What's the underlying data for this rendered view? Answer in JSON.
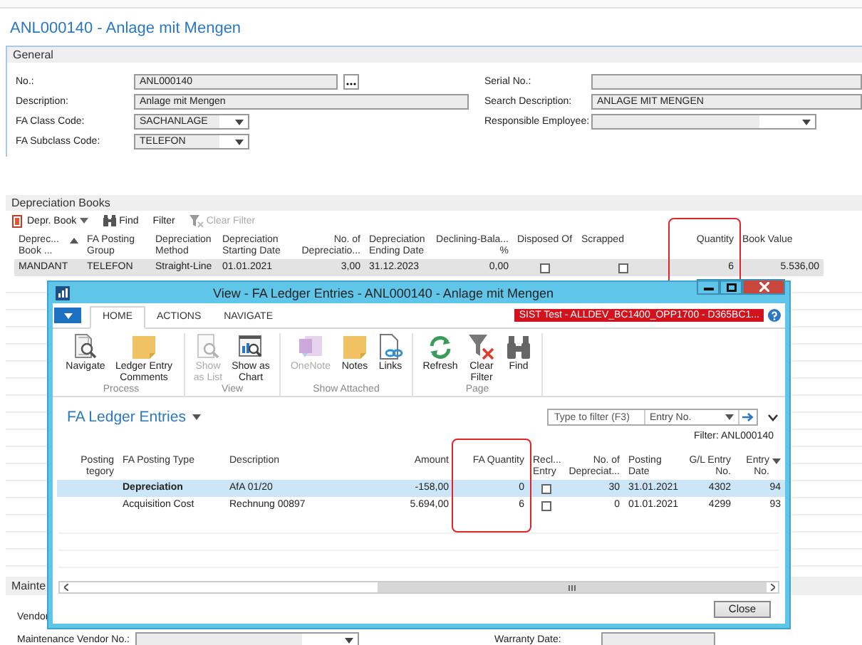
{
  "page": {
    "title": "ANL000140 - Anlage mit Mengen"
  },
  "general": {
    "heading": "General",
    "left_fields": [
      {
        "label": "No.:",
        "value": "ANL000140",
        "kind": "lookup"
      },
      {
        "label": "Description:",
        "value": "Anlage mit Mengen",
        "kind": "text"
      },
      {
        "label": "FA Class Code:",
        "value": "SACHANLAGE",
        "kind": "select"
      },
      {
        "label": "FA Subclass Code:",
        "value": "TELEFON",
        "kind": "select"
      }
    ],
    "right_fields": [
      {
        "label": "Serial No.:",
        "kind": "text"
      },
      {
        "label": "Search Description:",
        "value": "ANLAGE MIT MENGEN",
        "kind": "text"
      },
      {
        "label": "Responsible Employee:",
        "kind": "select"
      }
    ]
  },
  "depreciation_books": {
    "heading": "Depreciation Books",
    "toolbar": [
      {
        "label": "Depr. Book",
        "disabled": false
      },
      {
        "label": "Find",
        "disabled": false
      },
      {
        "label": "Filter",
        "disabled": false
      },
      {
        "label": "Clear Filter",
        "disabled": true
      }
    ],
    "columns": [
      {
        "label": "Deprec... Book ...",
        "sorted": true,
        "highlighted": false
      },
      {
        "label": "FA Posting Group",
        "sorted": false,
        "highlighted": false
      },
      {
        "label": "Depreciation Method",
        "sorted": false,
        "highlighted": false
      },
      {
        "label": "Depreciation Starting Date",
        "sorted": false,
        "highlighted": false
      },
      {
        "label": "No. of Depreciatio...",
        "sorted": false,
        "highlighted": false
      },
      {
        "label": "Depreciation Ending Date",
        "sorted": false,
        "highlighted": false
      },
      {
        "label": "Declining-Bala... %",
        "sorted": false,
        "highlighted": false
      },
      {
        "label": "Disposed Of",
        "sorted": false,
        "highlighted": false
      },
      {
        "label": "Scrapped",
        "sorted": false,
        "highlighted": false
      },
      {
        "label": "Quantity",
        "sorted": false,
        "highlighted": true
      },
      {
        "label": "Book Value",
        "sorted": false,
        "highlighted": false
      }
    ],
    "rows": [
      {
        "selected": true,
        "cells": [
          "MANDANT",
          "TELEFON",
          "Straight-Line",
          "01.01.2021",
          "3,00",
          "31.12.2023",
          "0,00",
          {
            "checked": false
          },
          {
            "checked": false
          },
          "6",
          "5.536,00"
        ]
      }
    ]
  },
  "maintenance": {
    "heading": "Mainte",
    "left_fields": [
      {
        "label": "Vendor",
        "kind": "covered"
      },
      {
        "label": "Maintenance Vendor No.:",
        "kind": "select"
      }
    ],
    "right_fields": [
      {
        "label": "Warranty Date:",
        "kind": "text"
      }
    ]
  },
  "dialog": {
    "title": "View - FA Ledger Entries - ANL000140 - Anlage mit Mengen",
    "tabs": [
      {
        "label": "HOME",
        "selected": true
      },
      {
        "label": "ACTIONS",
        "selected": false
      },
      {
        "label": "NAVIGATE",
        "selected": false
      }
    ],
    "environment_badge": "SIST Test - ALLDEV_BC1400_OPP1700 - D365BC1...",
    "ribbon_groups": [
      {
        "label": "Process",
        "actions": [
          {
            "label": "Navigate",
            "disabled": false
          },
          {
            "label": "Ledger Entry Comments",
            "disabled": false
          }
        ]
      },
      {
        "label": "View",
        "actions": [
          {
            "label": "Show as List",
            "disabled": true
          },
          {
            "label": "Show as Chart",
            "disabled": false
          }
        ]
      },
      {
        "label": "Show Attached",
        "actions": [
          {
            "label": "OneNote",
            "disabled": true
          },
          {
            "label": "Notes",
            "disabled": false
          },
          {
            "label": "Links",
            "disabled": false
          }
        ]
      },
      {
        "label": "Page",
        "actions": [
          {
            "label": "Refresh",
            "disabled": false
          },
          {
            "label": "Clear Filter",
            "disabled": false
          },
          {
            "label": "Find",
            "disabled": false
          }
        ]
      }
    ],
    "page_title": "FA Ledger Entries",
    "filter": {
      "placeholder": "Type to filter (F3)",
      "field": "Entry No."
    },
    "filter_caption": "Filter: ANL000140",
    "columns": [
      {
        "label": "Posting tegory",
        "sorted": false,
        "highlighted": false
      },
      {
        "label": "FA Posting Type",
        "sorted": false,
        "highlighted": false
      },
      {
        "label": "Description",
        "sorted": false,
        "highlighted": false
      },
      {
        "label": "Amount",
        "sorted": false,
        "highlighted": false
      },
      {
        "label": "FA Quantity",
        "sorted": false,
        "highlighted": true
      },
      {
        "label": "Recl... Entry",
        "sorted": false,
        "highlighted": false
      },
      {
        "label": "No. of Depreciat...",
        "sorted": false,
        "highlighted": false
      },
      {
        "label": "Posting Date",
        "sorted": false,
        "highlighted": false
      },
      {
        "label": "G/L Entry No.",
        "sorted": false,
        "highlighted": false
      },
      {
        "label": "Entry No.",
        "sorted": true,
        "highlighted": false
      }
    ],
    "rows": [
      {
        "selected": true,
        "cells": [
          "",
          "Depreciation",
          "AfA 01/20",
          "-158,00",
          "0",
          {
            "checked": false
          },
          "30",
          "31.01.2021",
          "4302",
          "94"
        ]
      },
      {
        "selected": false,
        "cells": [
          "",
          "Acquisition Cost",
          "Rechnung 00897",
          "5.694,00",
          "6",
          {
            "checked": false
          },
          "0",
          "01.01.2021",
          "4299",
          "93"
        ]
      }
    ],
    "close_button": "Close"
  }
}
